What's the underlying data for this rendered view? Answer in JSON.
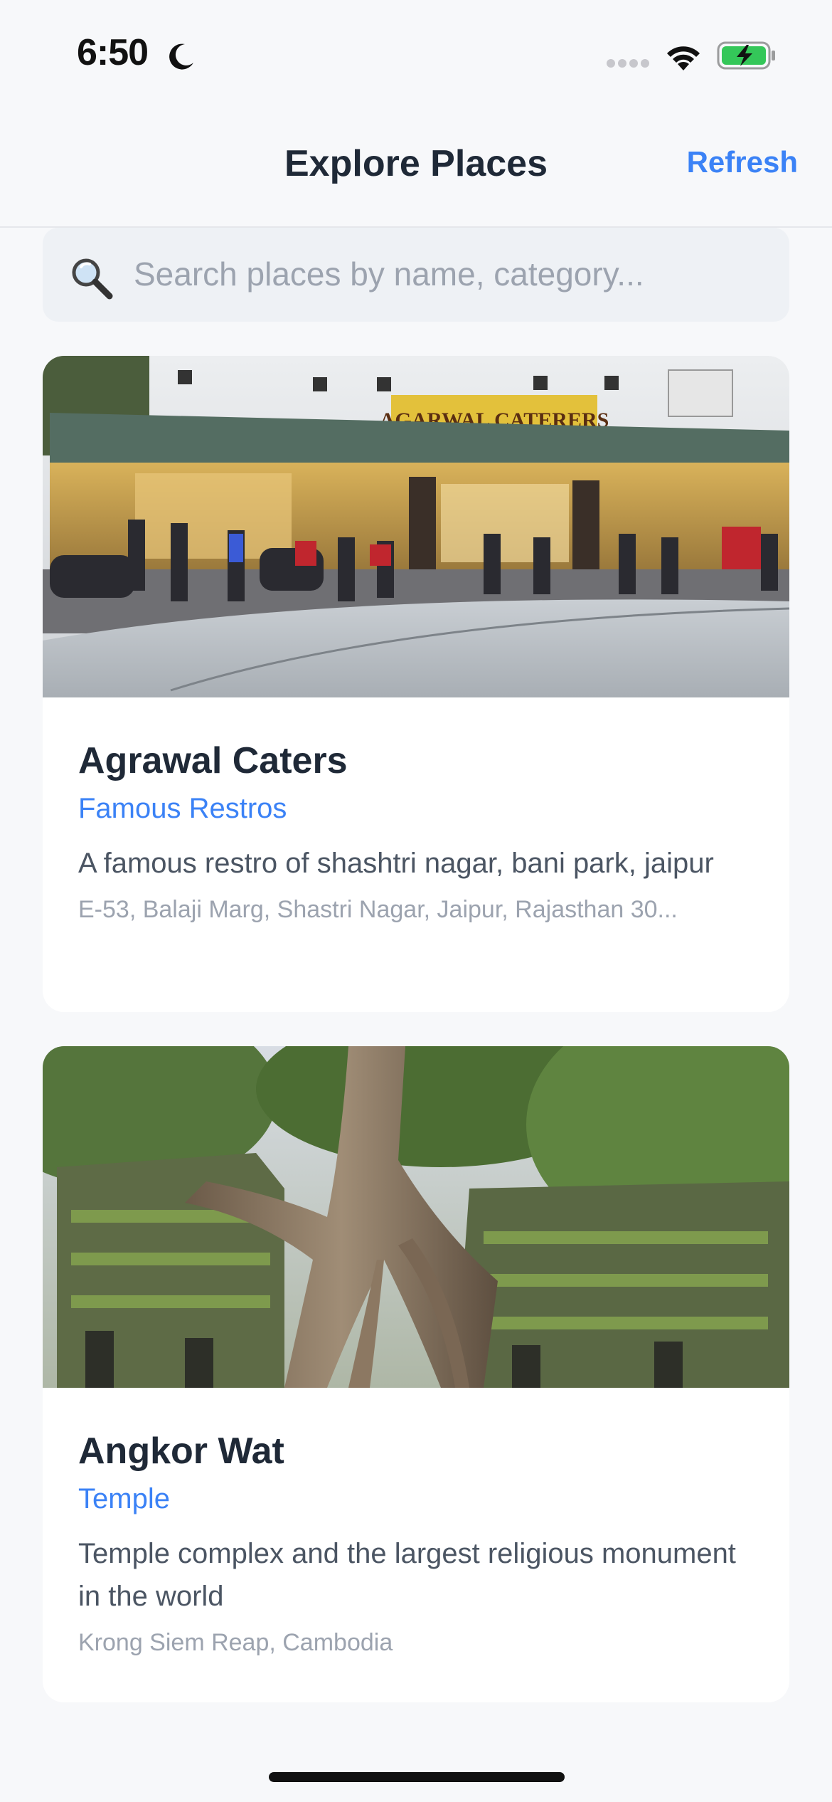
{
  "status_bar": {
    "time": "6:50"
  },
  "nav": {
    "title": "Explore Places",
    "refresh_label": "Refresh"
  },
  "search": {
    "placeholder": "Search places by name, category...",
    "value": ""
  },
  "places": [
    {
      "name": "Agrawal Caters",
      "category": "Famous Restros",
      "description": "A famous restro of shashtri nagar, bani park, jaipur",
      "address": "E-53, Balaji Marg, Shastri Nagar, Jaipur, Rajasthan 30...",
      "sign_text": "AGARWAL CATERERS"
    },
    {
      "name": "Angkor Wat",
      "category": "Temple",
      "description": "Temple complex and the largest religious monument in the world",
      "address": "Krong Siem Reap, Cambodia"
    }
  ],
  "colors": {
    "accent": "#3b82f6",
    "background": "#f7f8fa",
    "card": "#ffffff"
  }
}
